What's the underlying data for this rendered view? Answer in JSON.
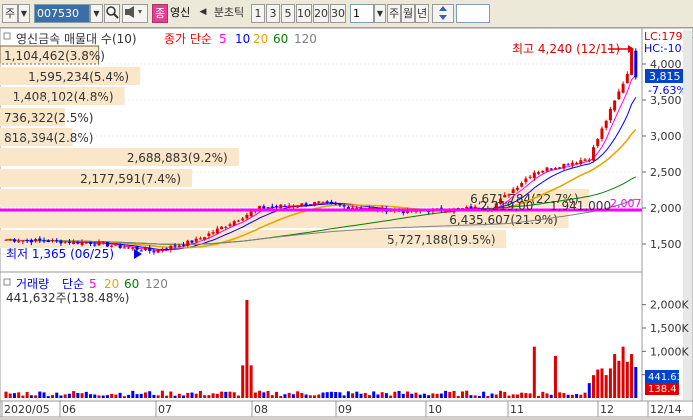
{
  "toolbar": {
    "market_tab": "주",
    "code": "007530",
    "name_badge": "종",
    "stock_name": "영신",
    "mode": "분초틱",
    "periods": [
      "1",
      "3",
      "5",
      "10",
      "20",
      "30"
    ],
    "period_value": "1",
    "units": [
      "주",
      "월",
      "년"
    ]
  },
  "price_panel": {
    "title": "영신금속 매물대 수(10)",
    "ma_label": "종가 단순",
    "ma_periods": [
      "5",
      "10",
      "20",
      "60",
      "120"
    ],
    "lc_label": "LC:179.4",
    "hc_label": "HC:-10.0",
    "high_label": "최고 4,240 (12/11)",
    "low_label": "최저 1,365 (06/25)",
    "current_price": "3,815",
    "change_pct": "-7.63%",
    "line_value": "2,007",
    "y_ticks": [
      "4,000",
      "3,500",
      "3,000",
      "2,500",
      "2,000",
      "1,500"
    ]
  },
  "volume_profile": [
    {
      "text": "1,104,462(3.8%)",
      "frac": 0.038
    },
    {
      "text": "1,595,234(5.4%)",
      "frac": 0.054
    },
    {
      "text": "1,408,102(4.8%)",
      "frac": 0.048
    },
    {
      "text": "736,322(2.5%)",
      "frac": 0.025
    },
    {
      "text": "818,394(2.8%)",
      "frac": 0.028
    },
    {
      "text": "2,688,883(9.2%)",
      "frac": 0.092
    },
    {
      "text": "2,177,591(7.4%)",
      "frac": 0.074
    },
    {
      "text": "6,671,784(22.7%)",
      "frac": 0.227
    },
    {
      "text": "6,435,607(21.9%)",
      "frac": 0.219
    },
    {
      "text": "5,727,188(19.5%)",
      "frac": 0.195
    }
  ],
  "other_labels": [
    "2,219,00",
    "1,941,000"
  ],
  "volume_panel": {
    "title": "거래량",
    "ma_label": "단순",
    "ma_periods": [
      "5",
      "20",
      "60",
      "120"
    ],
    "current": "441,632주(138.48%)",
    "y_ticks": [
      "2,000K",
      "1,500K",
      "1,000K",
      "500K"
    ],
    "right_value1": "441.63",
    "right_value2": "138.4"
  },
  "x_axis": [
    "2020/05",
    "06",
    "07",
    "08",
    "09",
    "10",
    "11",
    "12",
    "12/14"
  ],
  "colors": {
    "up": "#e00000",
    "down": "#0000ff",
    "ma5": "#ff00ff",
    "ma10": "#0000ff",
    "ma20": "#e6a800",
    "ma60": "#008000",
    "ma120": "#808080",
    "line": "#ff00ff",
    "profile_bar": "#fae6c8"
  }
}
